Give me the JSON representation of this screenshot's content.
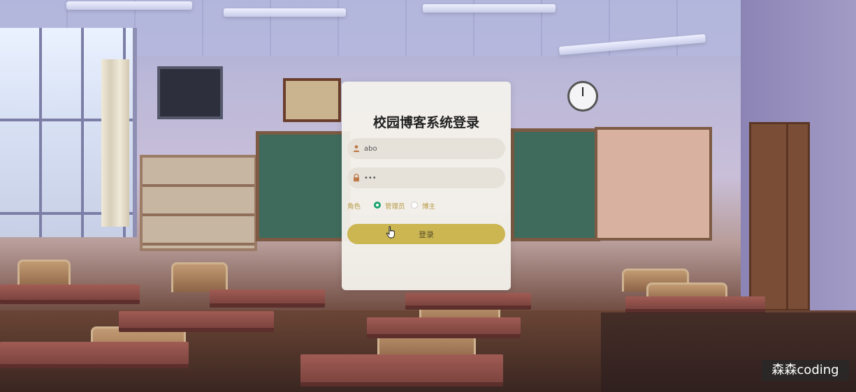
{
  "login": {
    "title": "校园博客系统登录",
    "username": {
      "value": "abo",
      "icon": "user-icon"
    },
    "password": {
      "value": "•••",
      "icon": "lock-icon"
    },
    "role": {
      "label": "角色",
      "options": [
        {
          "label": "管理员",
          "selected": true
        },
        {
          "label": "博主",
          "selected": false
        }
      ]
    },
    "submit_label": "登录"
  },
  "watermark": "森森coding",
  "colors": {
    "accent": "#cbb652",
    "role_text": "#b79a46",
    "radio_checked": "#1aa36f"
  }
}
